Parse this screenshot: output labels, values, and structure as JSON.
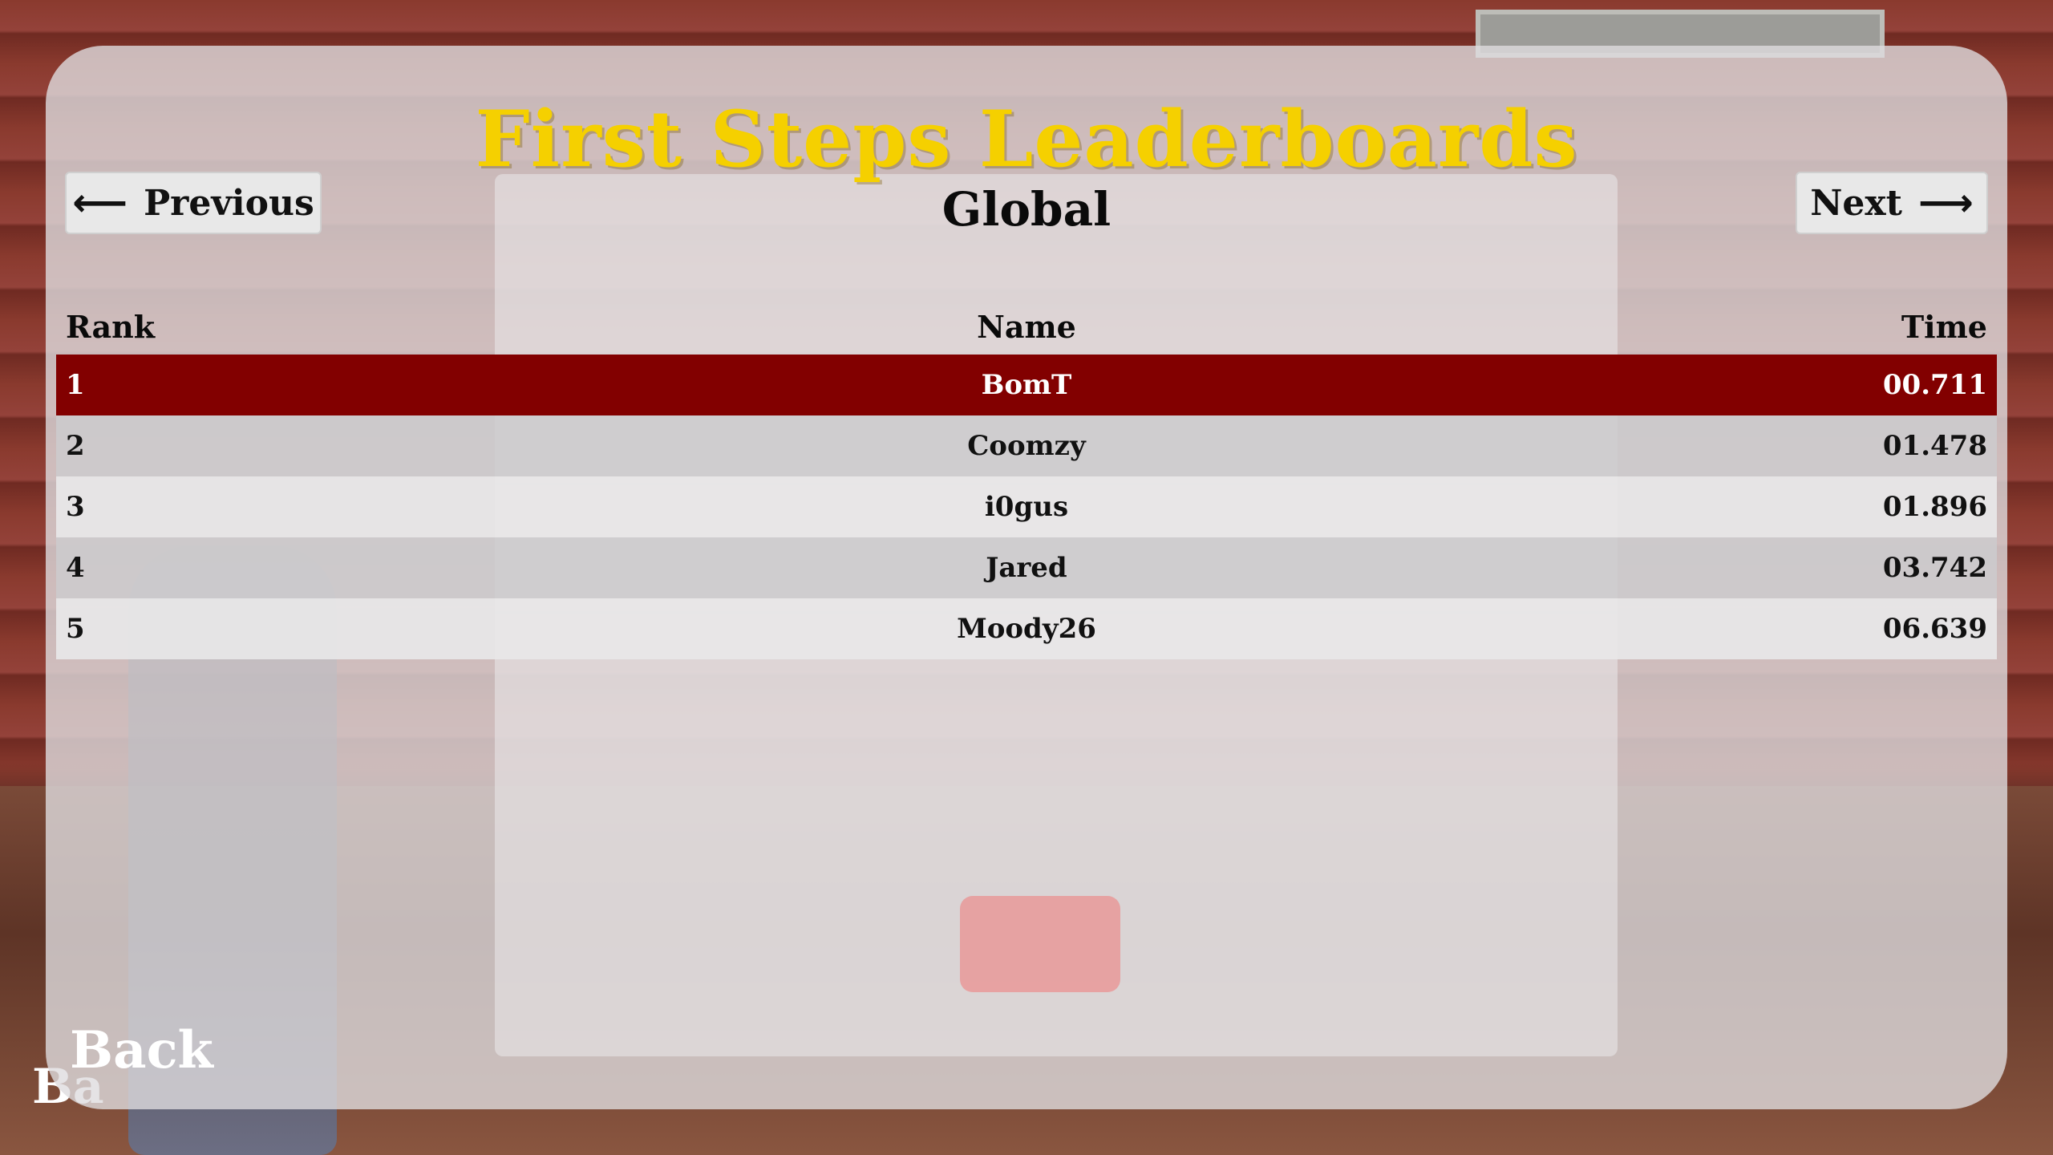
{
  "background": {
    "ghost_back_label": "Ba"
  },
  "title": "First Steps Leaderboards",
  "navigation": {
    "previous_label": "Previous",
    "previous_arrow": "⟵",
    "next_label": "Next",
    "next_arrow": "⟶",
    "scope_label": "Global"
  },
  "table": {
    "headers": {
      "rank": "Rank",
      "name": "Name",
      "time": "Time"
    },
    "rows": [
      {
        "rank": "1",
        "name": "BomT",
        "time": "00.711",
        "highlighted": true
      },
      {
        "rank": "2",
        "name": "Coomzy",
        "time": "01.478",
        "highlighted": false
      },
      {
        "rank": "3",
        "name": "i0gus",
        "time": "01.896",
        "highlighted": false
      },
      {
        "rank": "4",
        "name": "Jared",
        "time": "03.742",
        "highlighted": false
      },
      {
        "rank": "5",
        "name": "Moody26",
        "time": "06.639",
        "highlighted": false
      }
    ]
  },
  "back_label": "Back",
  "colors": {
    "title": "#f5d000",
    "highlight_row": "#820000",
    "panel": "#dedcde"
  }
}
